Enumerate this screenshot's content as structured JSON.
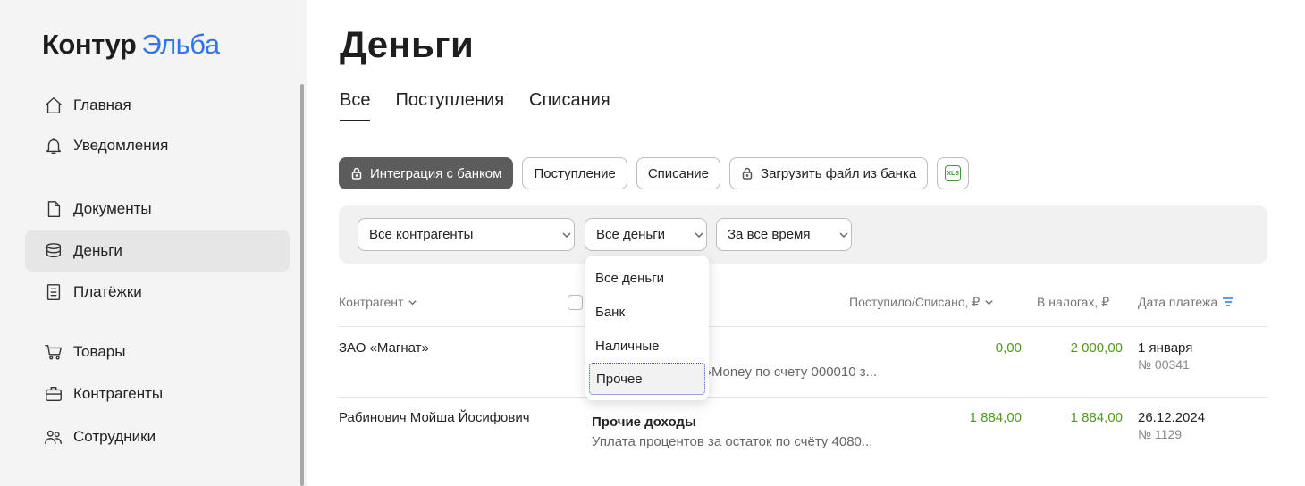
{
  "brand": {
    "part1": "Контур",
    "part2": "Эльба"
  },
  "sidebar": {
    "items": [
      {
        "label": "Главная",
        "icon": "home-icon"
      },
      {
        "label": "Уведомления",
        "icon": "bell-icon"
      },
      {
        "label": "Документы",
        "icon": "document-icon"
      },
      {
        "label": "Деньги",
        "icon": "coins-icon",
        "active": true
      },
      {
        "label": "Платёжки",
        "icon": "receipt-icon"
      },
      {
        "label": "Товары",
        "icon": "cart-icon"
      },
      {
        "label": "Контрагенты",
        "icon": "briefcase-icon"
      },
      {
        "label": "Сотрудники",
        "icon": "people-icon"
      }
    ]
  },
  "page": {
    "title": "Деньги"
  },
  "tabs": [
    {
      "label": "Все",
      "active": true
    },
    {
      "label": "Поступления"
    },
    {
      "label": "Списания"
    }
  ],
  "toolbar": {
    "bank_integration": "Интеграция с банком",
    "income": "Поступление",
    "expense": "Списание",
    "upload_file": "Загрузить файл из банка",
    "xls": "XLS"
  },
  "filters": {
    "counterparty": "Все контрагенты",
    "money": "Все деньги",
    "period": "За все время"
  },
  "dropdown": {
    "options": [
      "Все деньги",
      "Банк",
      "Наличные",
      "Прочее"
    ],
    "focused": "Прочее"
  },
  "table": {
    "headers": {
      "counterparty": "Контрагент",
      "amount": "Поступило/Списано, ₽",
      "taxes": "В налогах, ₽",
      "date": "Дата платежа"
    },
    "rows": [
      {
        "counterparty": "ЗАО «Магнат»",
        "title": "",
        "description": "›Money по счету 000010 з...",
        "amount": "0,00",
        "taxes": "2 000,00",
        "date": "1 января",
        "number": "№ 00341"
      },
      {
        "counterparty": "Рабинович Мойша Йосифович",
        "title": "Прочие доходы",
        "description": "Уплата процентов за остаток по счёту 4080...",
        "amount": "1 884,00",
        "taxes": "1 884,00",
        "date": "26.12.2024",
        "number": "№ 1129"
      }
    ]
  },
  "colors": {
    "accent_blue": "#2f77e6",
    "amount_green": "#4f9a1c",
    "dark_button": "#5c5c5c"
  }
}
